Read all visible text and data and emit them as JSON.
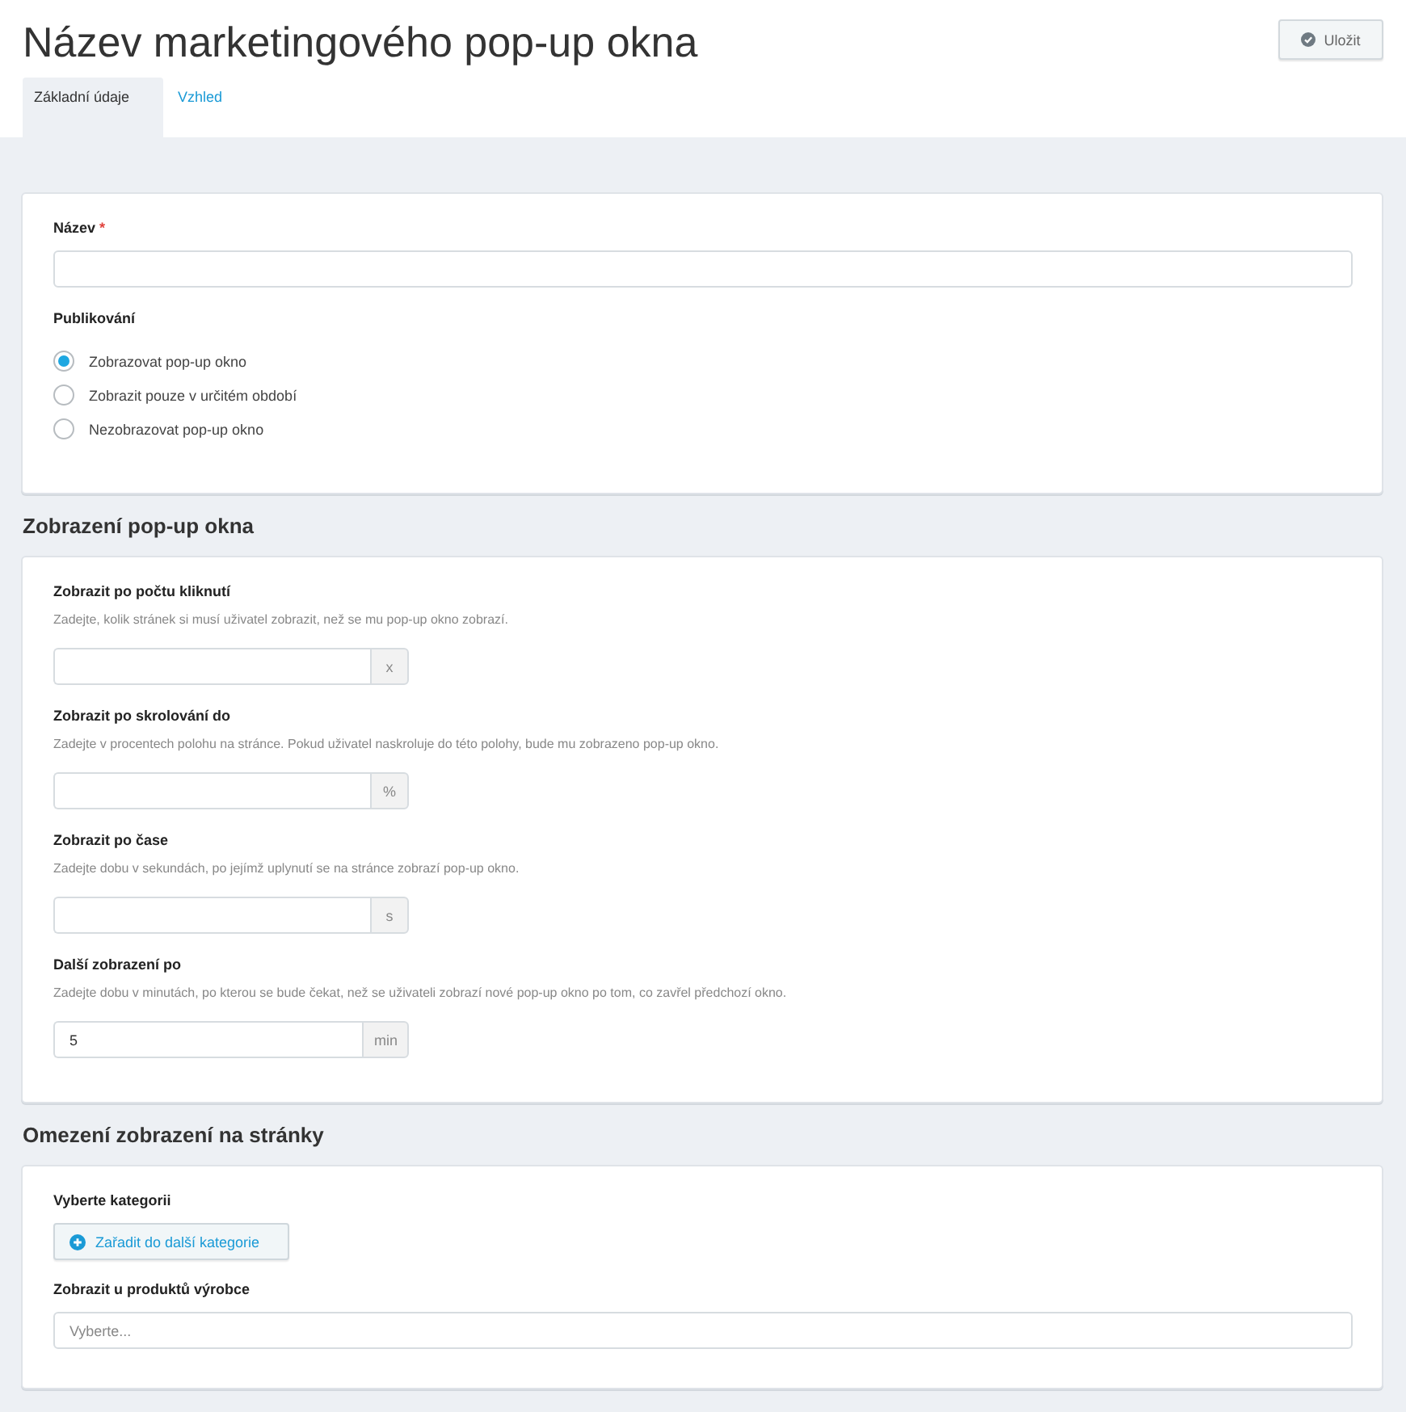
{
  "header": {
    "title": "Název marketingového pop-up okna",
    "save_button": "Uložit"
  },
  "tabs": [
    {
      "label": "Základní údaje",
      "selected": true
    },
    {
      "label": "Vzhled",
      "selected": false
    }
  ],
  "sections": [
    {
      "fields": [
        {
          "kind": "text",
          "label": "Název",
          "required_mark": "*"
        },
        {
          "kind": "radio_group",
          "label": "Publikování",
          "options": [
            {
              "label": "Zobrazovat pop-up okno",
              "selected": true
            },
            {
              "label": "Zobrazit pouze v určitém období",
              "selected": false
            },
            {
              "label": "Nezobrazovat pop-up okno",
              "selected": false
            }
          ]
        }
      ]
    },
    {
      "heading": "Zobrazení pop-up okna",
      "fields": [
        {
          "kind": "addon_input",
          "label": "Zobrazit po počtu kliknutí",
          "hint": "Zadejte, kolik stránek si musí uživatel zobrazit, než se mu pop-up okno zobrazí.",
          "suffix": "x"
        },
        {
          "kind": "addon_input",
          "label": "Zobrazit po skrolování do",
          "hint": "Zadejte v procentech polohu na stránce. Pokud uživatel naskroluje do této polohy, bude mu zobrazeno pop-up okno.",
          "suffix": "%"
        },
        {
          "kind": "addon_input",
          "label": "Zobrazit po čase",
          "hint": "Zadejte dobu v sekundách, po jejímž uplynutí se na stránce zobrazí pop-up okno.",
          "suffix": "s"
        },
        {
          "kind": "addon_input",
          "label": "Další zobrazení po",
          "hint": "Zadejte dobu v minutách, po kterou se bude čekat, než se uživateli zobrazí nové pop-up okno po tom, co zavřel předchozí okno.",
          "value": "5",
          "suffix": "min"
        }
      ]
    },
    {
      "heading": "Omezení zobrazení na stránky",
      "fields": [
        {
          "kind": "button",
          "label": "Vyberte kategorii",
          "button": "Zařadit do další kategorie"
        },
        {
          "kind": "select",
          "label": "Zobrazit u produktů výrobce",
          "placeholder": "Vyberte..."
        }
      ]
    }
  ]
}
